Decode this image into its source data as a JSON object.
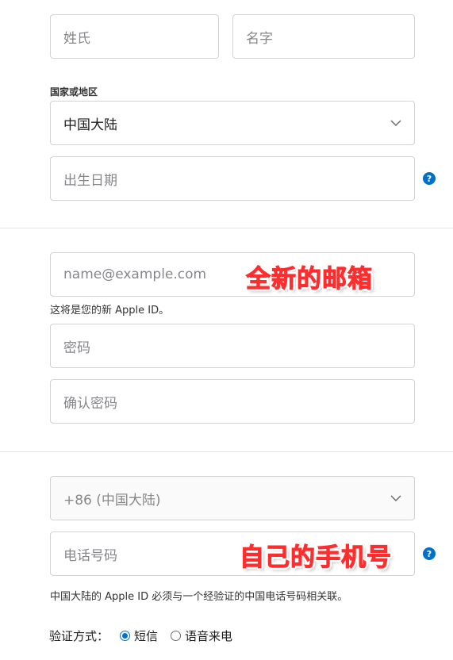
{
  "name": {
    "last_name_placeholder": "姓氏",
    "first_name_placeholder": "名字"
  },
  "country": {
    "label": "国家或地区",
    "selected": "中国大陆"
  },
  "birthday": {
    "placeholder": "出生日期",
    "help": "?"
  },
  "account": {
    "email_placeholder": "name@example.com",
    "email_hint": "这将是您的新 Apple ID。",
    "password_placeholder": "密码",
    "confirm_password_placeholder": "确认密码"
  },
  "phone": {
    "country_code": "+86 (中国大陆)",
    "number_placeholder": "电话号码",
    "help": "?",
    "hint": "中国大陆的 Apple ID 必须与一个经验证的中国电话号码相关联。"
  },
  "verify": {
    "label": "验证方式：",
    "options": [
      {
        "label": "短信",
        "checked": true
      },
      {
        "label": "语音来电",
        "checked": false
      }
    ]
  },
  "annotations": {
    "email_note": "全新的邮箱",
    "phone_note": "自己的手机号",
    "color": "#ff2d2d"
  },
  "colors": {
    "accent": "#0070c9",
    "border": "#d2d2d7",
    "placeholder": "#86868b"
  }
}
